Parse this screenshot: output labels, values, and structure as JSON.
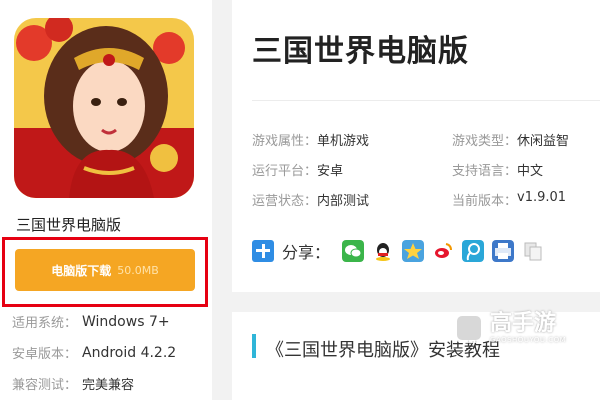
{
  "app": {
    "name": "三国世界电脑版",
    "download_label": "电脑版下载",
    "download_size": "50.0MB"
  },
  "sidebar_info": [
    {
      "label": "适用系统：",
      "value": "Windows 7+"
    },
    {
      "label": "安卓版本：",
      "value": "Android 4.2.2"
    },
    {
      "label": "兼容测试：",
      "value": "完美兼容"
    }
  ],
  "main": {
    "title": "三国世界电脑版",
    "attributes": [
      {
        "label": "游戏属性：",
        "value": "单机游戏"
      },
      {
        "label": "游戏类型：",
        "value": "休闲益智"
      },
      {
        "label": "运行平台：",
        "value": "安卓"
      },
      {
        "label": "支持语言：",
        "value": "中文"
      },
      {
        "label": "运营状态：",
        "value": "内部测试"
      },
      {
        "label": "当前版本：",
        "value": "v1.9.01"
      }
    ],
    "share_label": "分享：",
    "share_icons": [
      "wechat-icon",
      "qq-icon",
      "qzone-icon",
      "weibo-icon",
      "tencent-weibo-icon",
      "print-icon",
      "copy-icon"
    ]
  },
  "tutorial": {
    "title": "《三国世界电脑版》安装教程"
  },
  "watermark": {
    "brand": "高手游",
    "url": "GAOSHOUYOU.COM"
  },
  "colors": {
    "download_button": "#f5a623",
    "highlight_frame": "#e60012",
    "accent_bar": "#2fb5d8",
    "share_plus": "#2f8de4"
  }
}
